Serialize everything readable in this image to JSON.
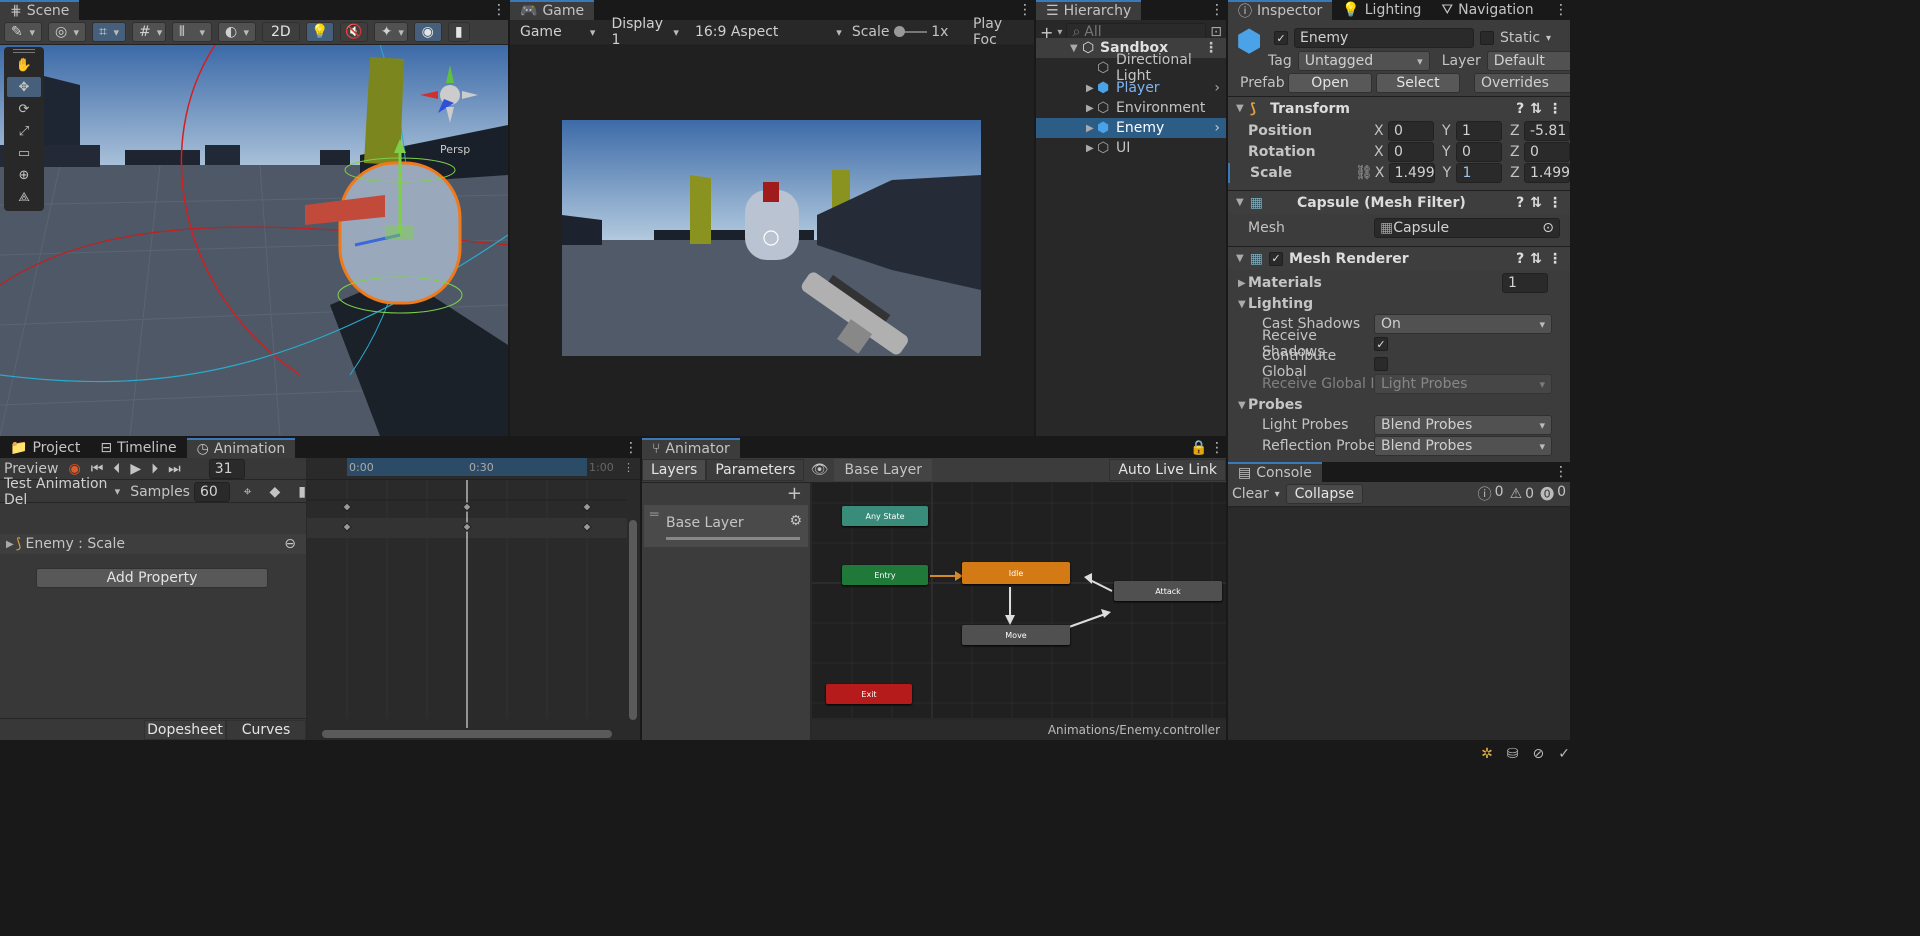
{
  "scene": {
    "tab": "Scene",
    "persp": "Persp",
    "btn2d": "2D"
  },
  "game": {
    "tab": "Game",
    "mode": "Game",
    "display": "Display 1",
    "aspect": "16:9 Aspect",
    "scale_label": "Scale",
    "scale_value": "1x",
    "play_focus": "Play Foc"
  },
  "hierarchy": {
    "tab": "Hierarchy",
    "search_placeholder": "All",
    "scene": "Sandbox",
    "items": [
      "Directional Light",
      "Player",
      "Environment",
      "Enemy",
      "UI"
    ]
  },
  "inspector": {
    "tabs": [
      "Inspector",
      "Lighting",
      "Navigation"
    ],
    "name": "Enemy",
    "static_label": "Static",
    "tag_label": "Tag",
    "tag": "Untagged",
    "layer_label": "Layer",
    "layer": "Default",
    "prefab_label": "Prefab",
    "open": "Open",
    "select": "Select",
    "overrides": "Overrides",
    "transform": {
      "title": "Transform",
      "rows": [
        {
          "label": "Position",
          "x": "0",
          "y": "1",
          "z": "-5.81"
        },
        {
          "label": "Rotation",
          "x": "0",
          "y": "0",
          "z": "0"
        },
        {
          "label": "Scale",
          "x": "1.499",
          "y": "1",
          "z": "1.499"
        }
      ]
    },
    "meshfilter": {
      "title": "Capsule (Mesh Filter)",
      "mesh_label": "Mesh",
      "mesh": "Capsule"
    },
    "renderer": {
      "title": "Mesh Renderer",
      "materials": "Materials",
      "materials_count": "1",
      "lighting": "Lighting",
      "cast_shadows": "Cast Shadows",
      "cast_value": "On",
      "receive_shadows": "Receive Shadows",
      "contribute_gi": "Contribute Global",
      "receive_gi": "Receive Global Illu",
      "receive_gi_value": "Light Probes",
      "probes": "Probes",
      "light_probes": "Light Probes",
      "light_probes_value": "Blend Probes",
      "reflection_probes": "Reflection Probes",
      "reflection_value": "Blend Probes"
    }
  },
  "console": {
    "tab": "Console",
    "clear": "Clear",
    "collapse": "Collapse",
    "info": "0",
    "warn": "0",
    "error": "0"
  },
  "bottom": {
    "tabs": [
      "Project",
      "Timeline",
      "Animation"
    ]
  },
  "animation": {
    "preview": "Preview",
    "frame": "31",
    "clip": "Test Animation Del",
    "samples_label": "Samples",
    "samples": "60",
    "times": [
      "0:00",
      "0:30",
      "1:00"
    ],
    "property": "Enemy : Scale",
    "add_property": "Add Property",
    "dopesheet": "Dopesheet",
    "curves": "Curves"
  },
  "animator": {
    "tab": "Animator",
    "layers": "Layers",
    "parameters": "Parameters",
    "crumb": "Base Layer",
    "autolive": "Auto Live Link",
    "layer_name": "Base Layer",
    "states": {
      "any": "Any State",
      "entry": "Entry",
      "idle": "Idle",
      "attack": "Attack",
      "move": "Move",
      "exit": "Exit"
    },
    "path": "Animations/Enemy.controller"
  },
  "colors": {
    "accent": "#3a79bb",
    "idle": "#d47a14",
    "entry": "#1f7a3a",
    "any": "#3a8c7a",
    "exit": "#b51b1b",
    "state": "#505050"
  }
}
